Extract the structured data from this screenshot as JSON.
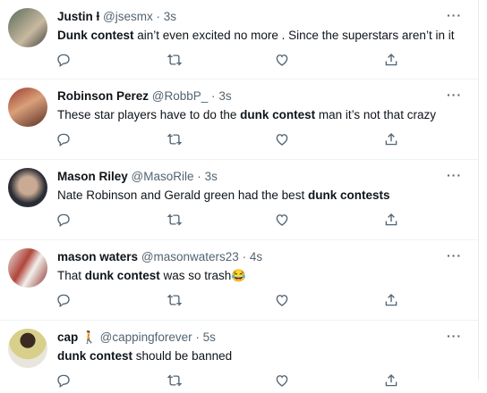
{
  "tweets": [
    {
      "name": "Justin ƚ",
      "handle": "@jsesmx",
      "dot": "·",
      "time": "3s",
      "text_bold": "Dunk contest",
      "text_rest": " ain’t even excited no more . Since the superstars aren’t in it",
      "emoji": ""
    },
    {
      "name": "Robinson Perez",
      "handle": "@RobbP_",
      "dot": "·",
      "time": "3s",
      "text_pre": "These star players have to do the ",
      "text_bold": "dunk contest",
      "text_rest": " man it’s not that crazy"
    },
    {
      "name": "Mason Riley",
      "handle": "@MasoRile",
      "dot": "·",
      "time": "3s",
      "text_pre": "Nate Robinson and Gerald green had the best ",
      "text_bold": "dunk contests",
      "text_rest": ""
    },
    {
      "name": "mason waters",
      "handle": "@masonwaters23",
      "dot": "·",
      "time": "4s",
      "text_pre": "That ",
      "text_bold": "dunk contest",
      "text_rest": " was so trash",
      "emoji": "😂"
    },
    {
      "name": "cap",
      "name_emoji": "🚶",
      "handle": "@cappingforever",
      "dot": "·",
      "time": "5s",
      "text_pre": "",
      "text_bold": "dunk contest",
      "text_rest": " should be banned"
    }
  ],
  "more_label": "···",
  "icons": [
    "reply-icon",
    "retweet-icon",
    "like-icon",
    "share-icon"
  ],
  "colors": {
    "text": "#0f1419",
    "secondary": "#536471",
    "divider": "#eff3f4"
  }
}
